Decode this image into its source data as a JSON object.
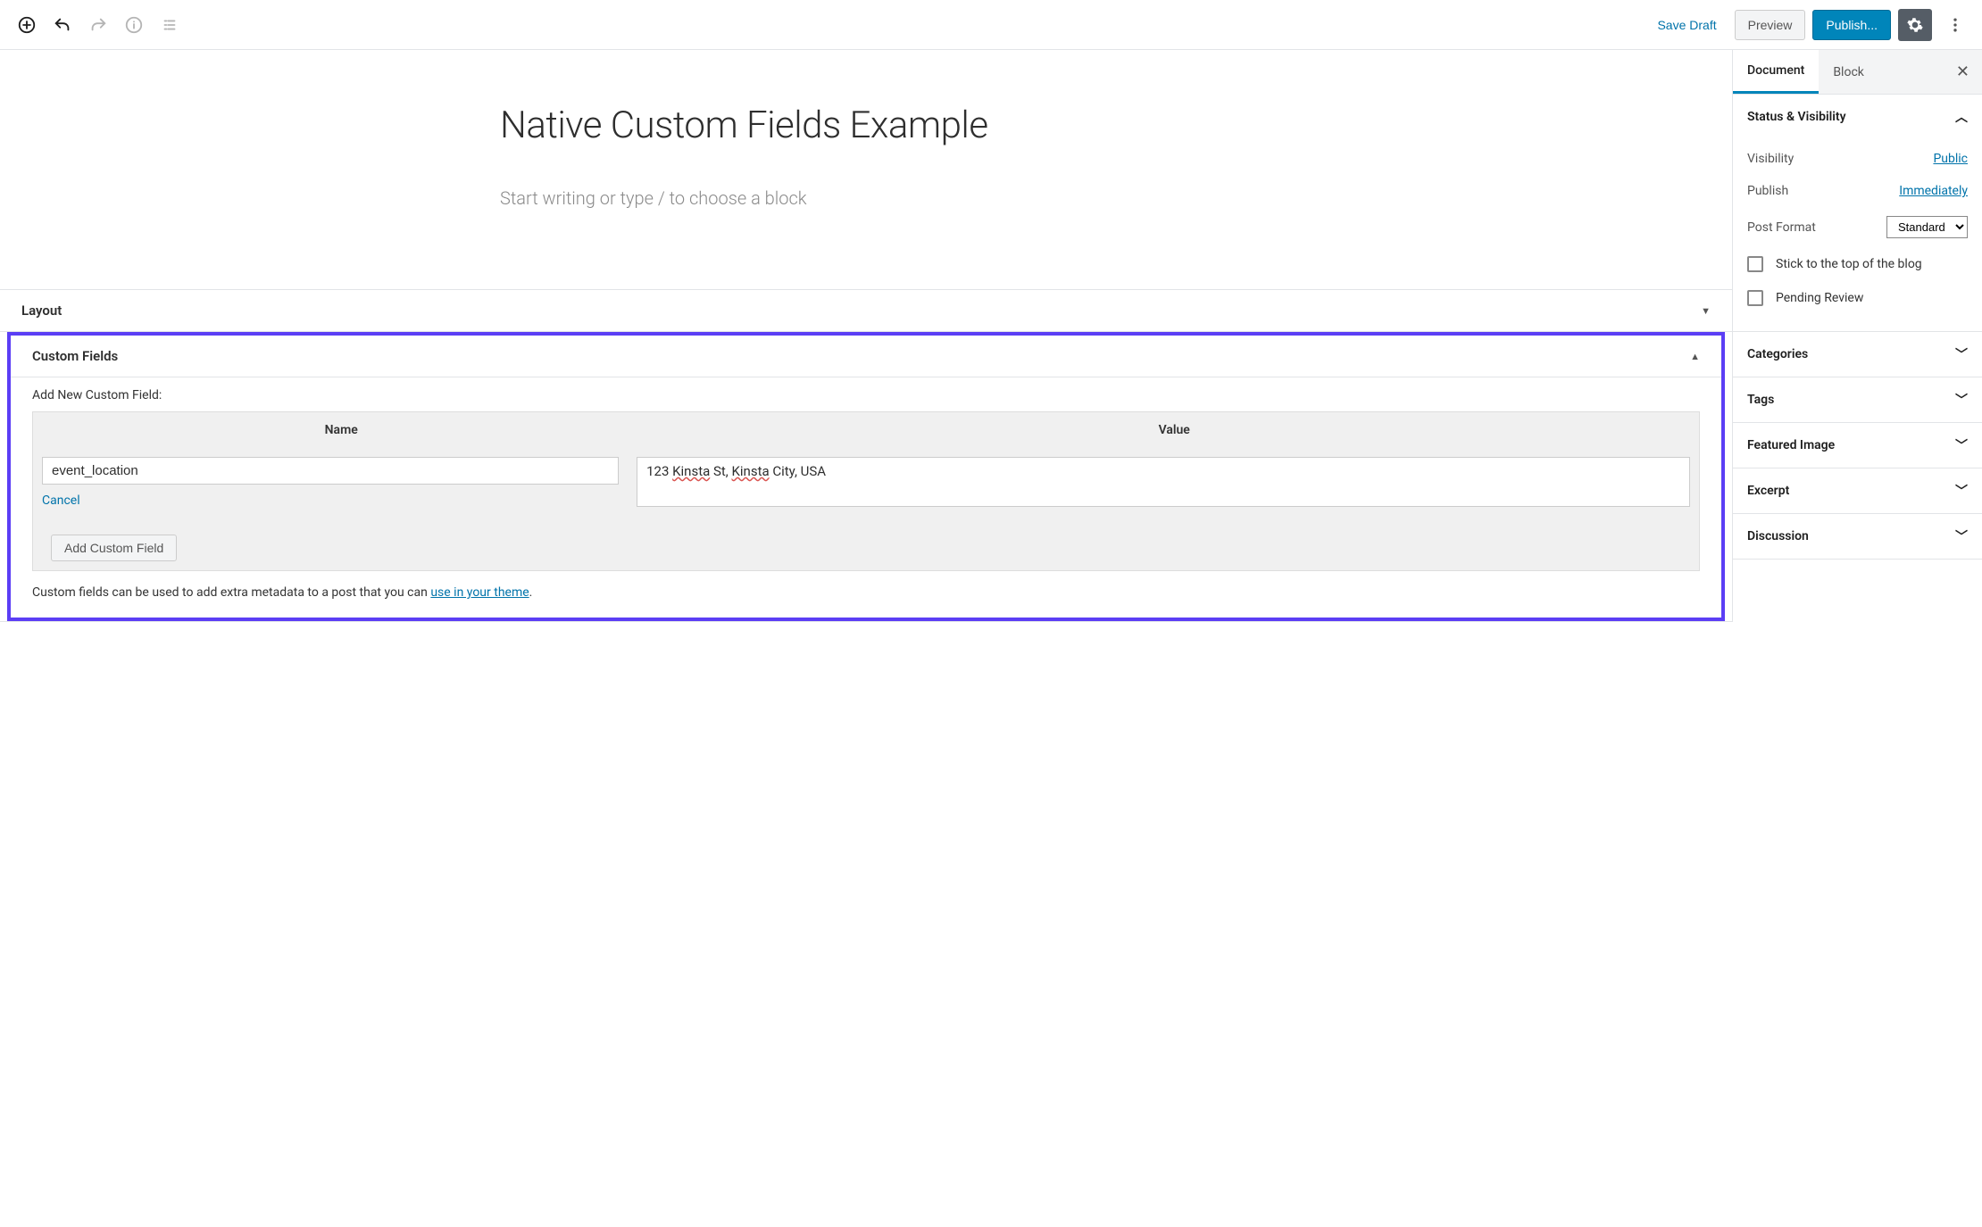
{
  "toolbar": {
    "save_draft": "Save Draft",
    "preview": "Preview",
    "publish": "Publish..."
  },
  "post": {
    "title": "Native Custom Fields Example",
    "placeholder": "Start writing or type / to choose a block"
  },
  "metaboxes": {
    "layout": {
      "title": "Layout"
    },
    "custom_fields": {
      "title": "Custom Fields",
      "add_new_label": "Add New Custom Field:",
      "col_name": "Name",
      "col_value": "Value",
      "name_value": "event_location",
      "value_value": "123 Kinsta St, Kinsta City, USA",
      "cancel": "Cancel",
      "add_button": "Add Custom Field",
      "help_prefix": "Custom fields can be used to add extra metadata to a post that you can ",
      "help_link": "use in your theme",
      "help_suffix": "."
    }
  },
  "sidebar": {
    "tabs": {
      "document": "Document",
      "block": "Block"
    },
    "status": {
      "title": "Status & Visibility",
      "visibility_label": "Visibility",
      "visibility_value": "Public",
      "publish_label": "Publish",
      "publish_value": "Immediately",
      "format_label": "Post Format",
      "format_value": "Standard",
      "stick": "Stick to the top of the blog",
      "pending": "Pending Review"
    },
    "panels": {
      "categories": "Categories",
      "tags": "Tags",
      "featured_image": "Featured Image",
      "excerpt": "Excerpt",
      "discussion": "Discussion"
    }
  }
}
